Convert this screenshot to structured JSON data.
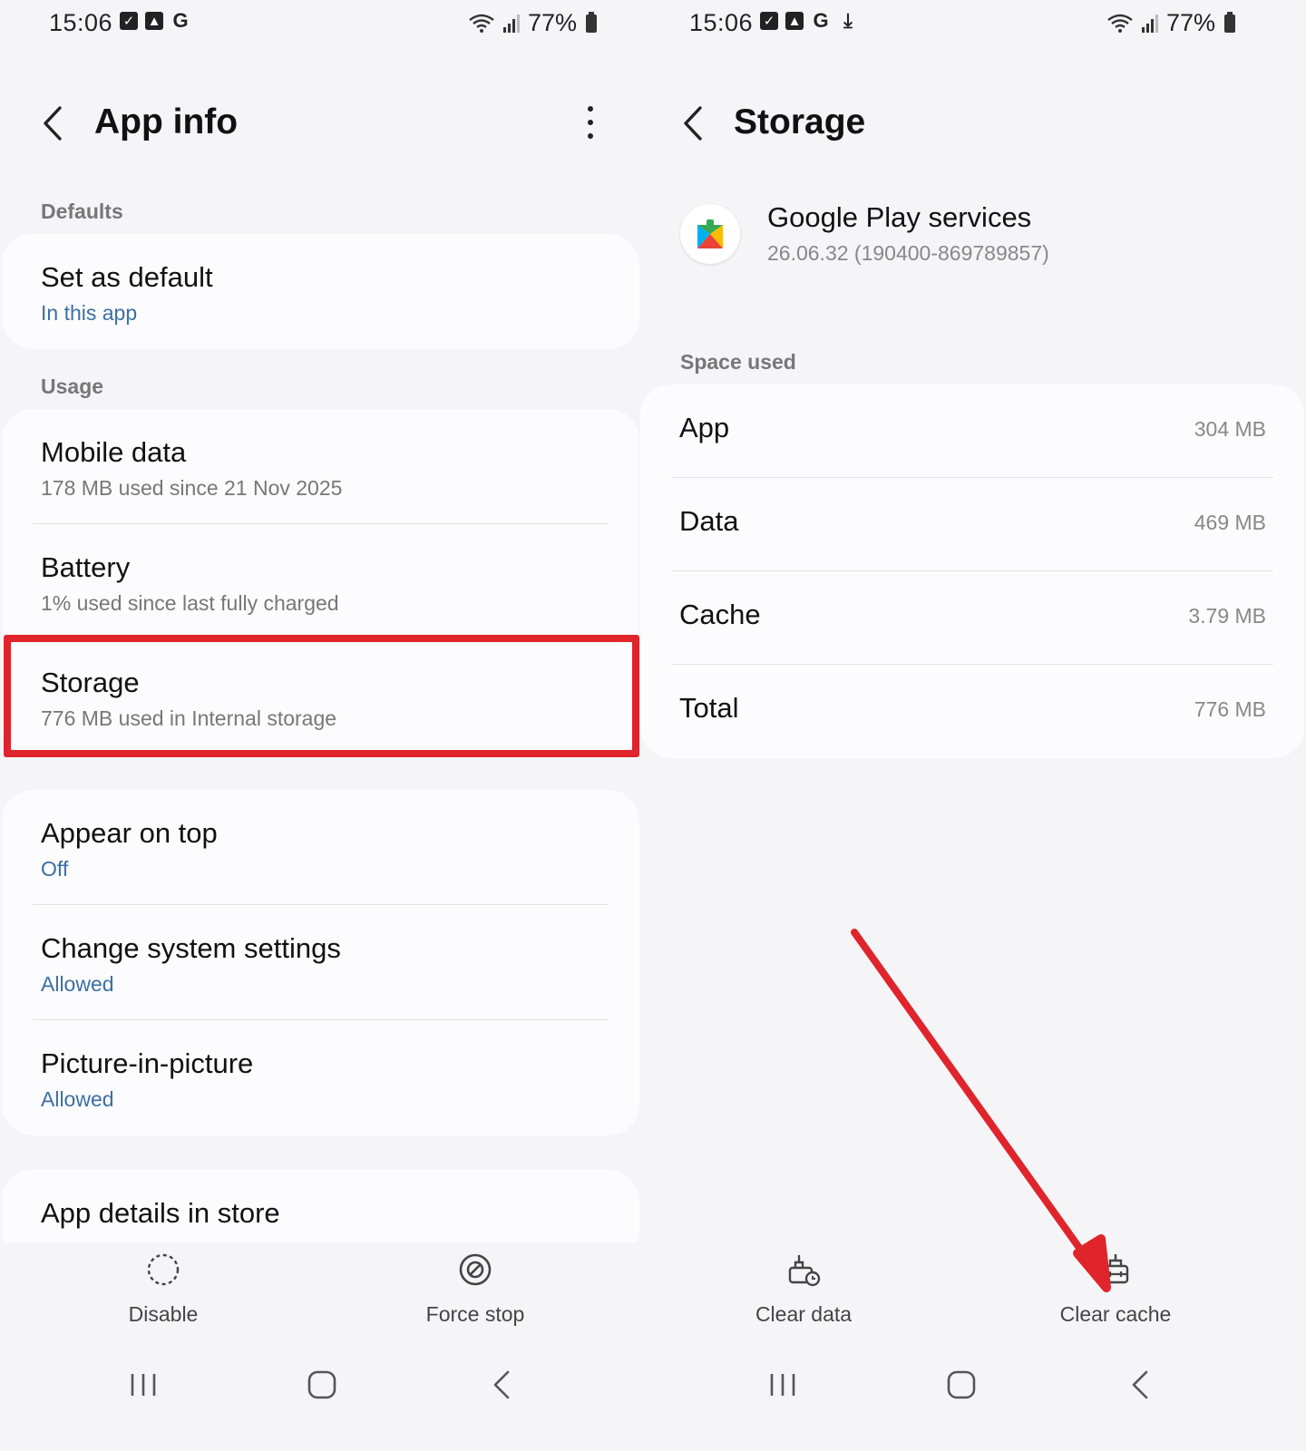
{
  "left": {
    "status": {
      "time": "15:06",
      "battery": "77%"
    },
    "header": {
      "title": "App info"
    },
    "sections": {
      "defaults_label": "Defaults",
      "usage_label": "Usage"
    },
    "defaults": [
      {
        "title": "Set as default",
        "subtitle": "In this app"
      }
    ],
    "usage": [
      {
        "title": "Mobile data",
        "subtitle": "178 MB used since 21 Nov 2025"
      },
      {
        "title": "Battery",
        "subtitle": "1% used since last fully charged"
      },
      {
        "title": "Storage",
        "subtitle": "776 MB used in Internal storage"
      }
    ],
    "permissions": [
      {
        "title": "Appear on top",
        "subtitle": "Off"
      },
      {
        "title": "Change system settings",
        "subtitle": "Allowed"
      },
      {
        "title": "Picture-in-picture",
        "subtitle": "Allowed"
      }
    ],
    "store": {
      "title": "App details in store"
    },
    "actions": {
      "disable": "Disable",
      "force_stop": "Force stop"
    }
  },
  "right": {
    "status": {
      "time": "15:06",
      "battery": "77%"
    },
    "header": {
      "title": "Storage"
    },
    "app": {
      "name": "Google Play services",
      "version": "26.06.32 (190400-869789857)"
    },
    "space_used_label": "Space used",
    "storage": [
      {
        "label": "App",
        "value": "304 MB"
      },
      {
        "label": "Data",
        "value": "469 MB"
      },
      {
        "label": "Cache",
        "value": "3.79 MB"
      },
      {
        "label": "Total",
        "value": "776 MB"
      }
    ],
    "actions": {
      "clear_data": "Clear data",
      "clear_cache": "Clear cache"
    }
  },
  "colors": {
    "highlight": "#e0242b",
    "link_blue": "#3c6fa3",
    "background": "#f5f5f7"
  }
}
